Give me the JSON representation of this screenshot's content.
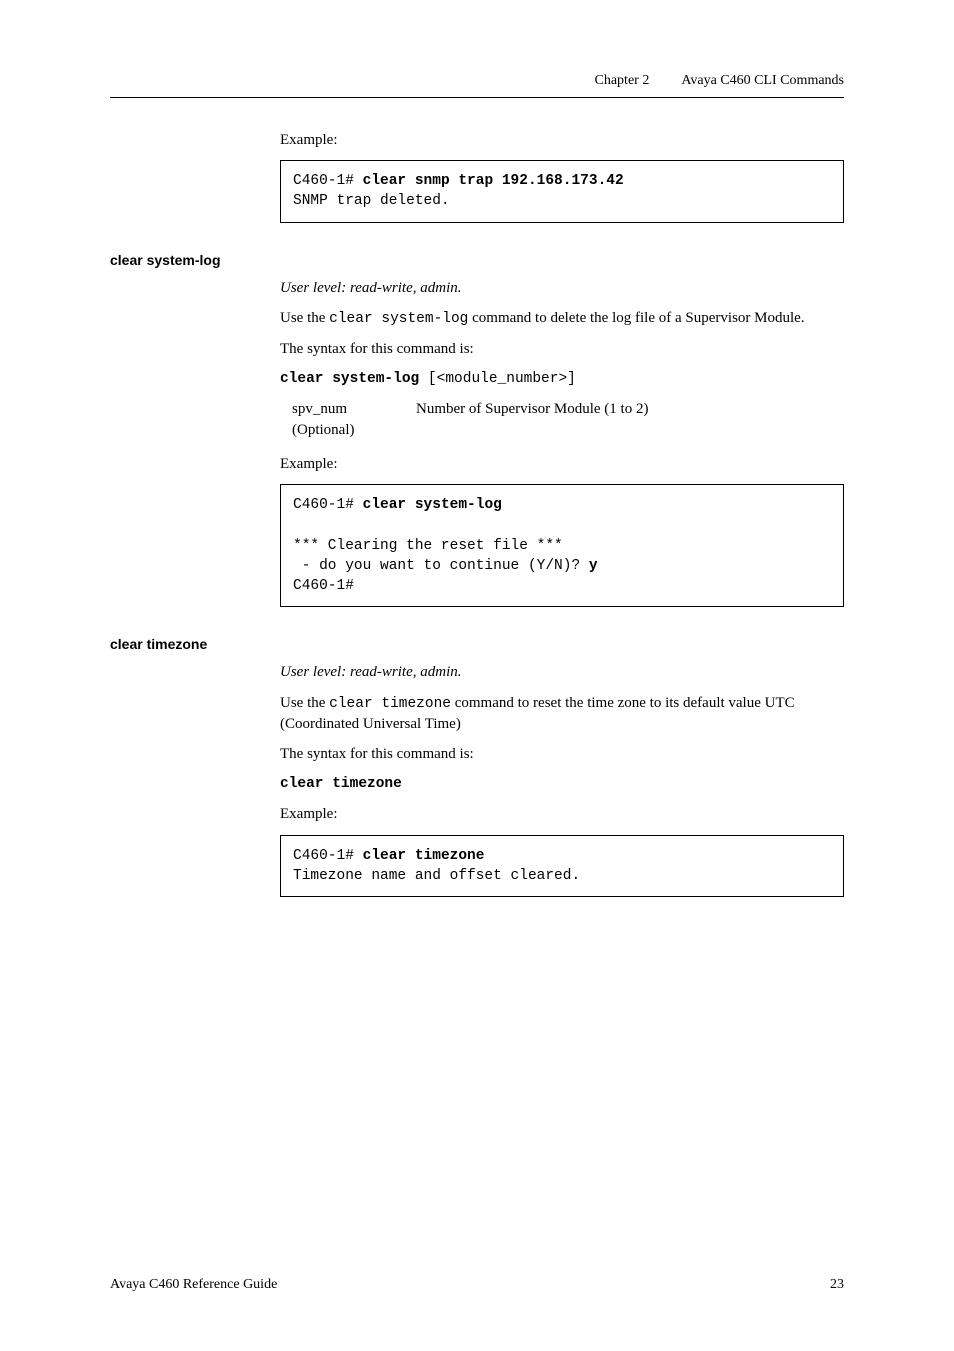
{
  "header": {
    "chapter": "Chapter 2",
    "title": "Avaya C460 CLI Commands"
  },
  "intro": {
    "example_label": "Example:",
    "code_line1_prompt": "C460-1# ",
    "code_line1_cmd": "clear snmp trap 192.168.173.42",
    "code_line2": "SNMP trap deleted."
  },
  "clear_system_log": {
    "heading": "clear system-log",
    "userlevel": "User level: read-write, admin.",
    "desc_prefix": "Use the ",
    "desc_code": "clear system-log",
    "desc_suffix": " command to delete the log file of a Supervisor Module.",
    "syntax_label": "The syntax for this command is:",
    "syntax_cmd": "clear system-log",
    "syntax_args": " [<module_number>]",
    "param_name1": "spv_num",
    "param_name2": "(Optional)",
    "param_desc": "Number of Supervisor Module (1 to 2)",
    "example_label": "Example:",
    "code_l1_prompt": "C460-1# ",
    "code_l1_cmd": "clear system-log",
    "code_blank": "",
    "code_l2": "*** Clearing the reset file ***",
    "code_l3_prefix": " - do you want to continue (Y/N)? ",
    "code_l3_bold": "y",
    "code_l4": "C460-1#"
  },
  "clear_timezone": {
    "heading": "clear timezone",
    "userlevel": "User level: read-write, admin.",
    "desc_prefix": "Use the ",
    "desc_code": "clear timezone",
    "desc_suffix": " command to reset the time zone to its default value UTC (Coordinated Universal Time)",
    "syntax_label": "The syntax for this command is:",
    "syntax_cmd": "clear timezone",
    "example_label": "Example:",
    "code_l1_prompt": "C460-1# ",
    "code_l1_cmd": "clear timezone",
    "code_l2": "Timezone name and offset cleared."
  },
  "footer": {
    "left": "Avaya C460 Reference Guide",
    "right": "23"
  }
}
